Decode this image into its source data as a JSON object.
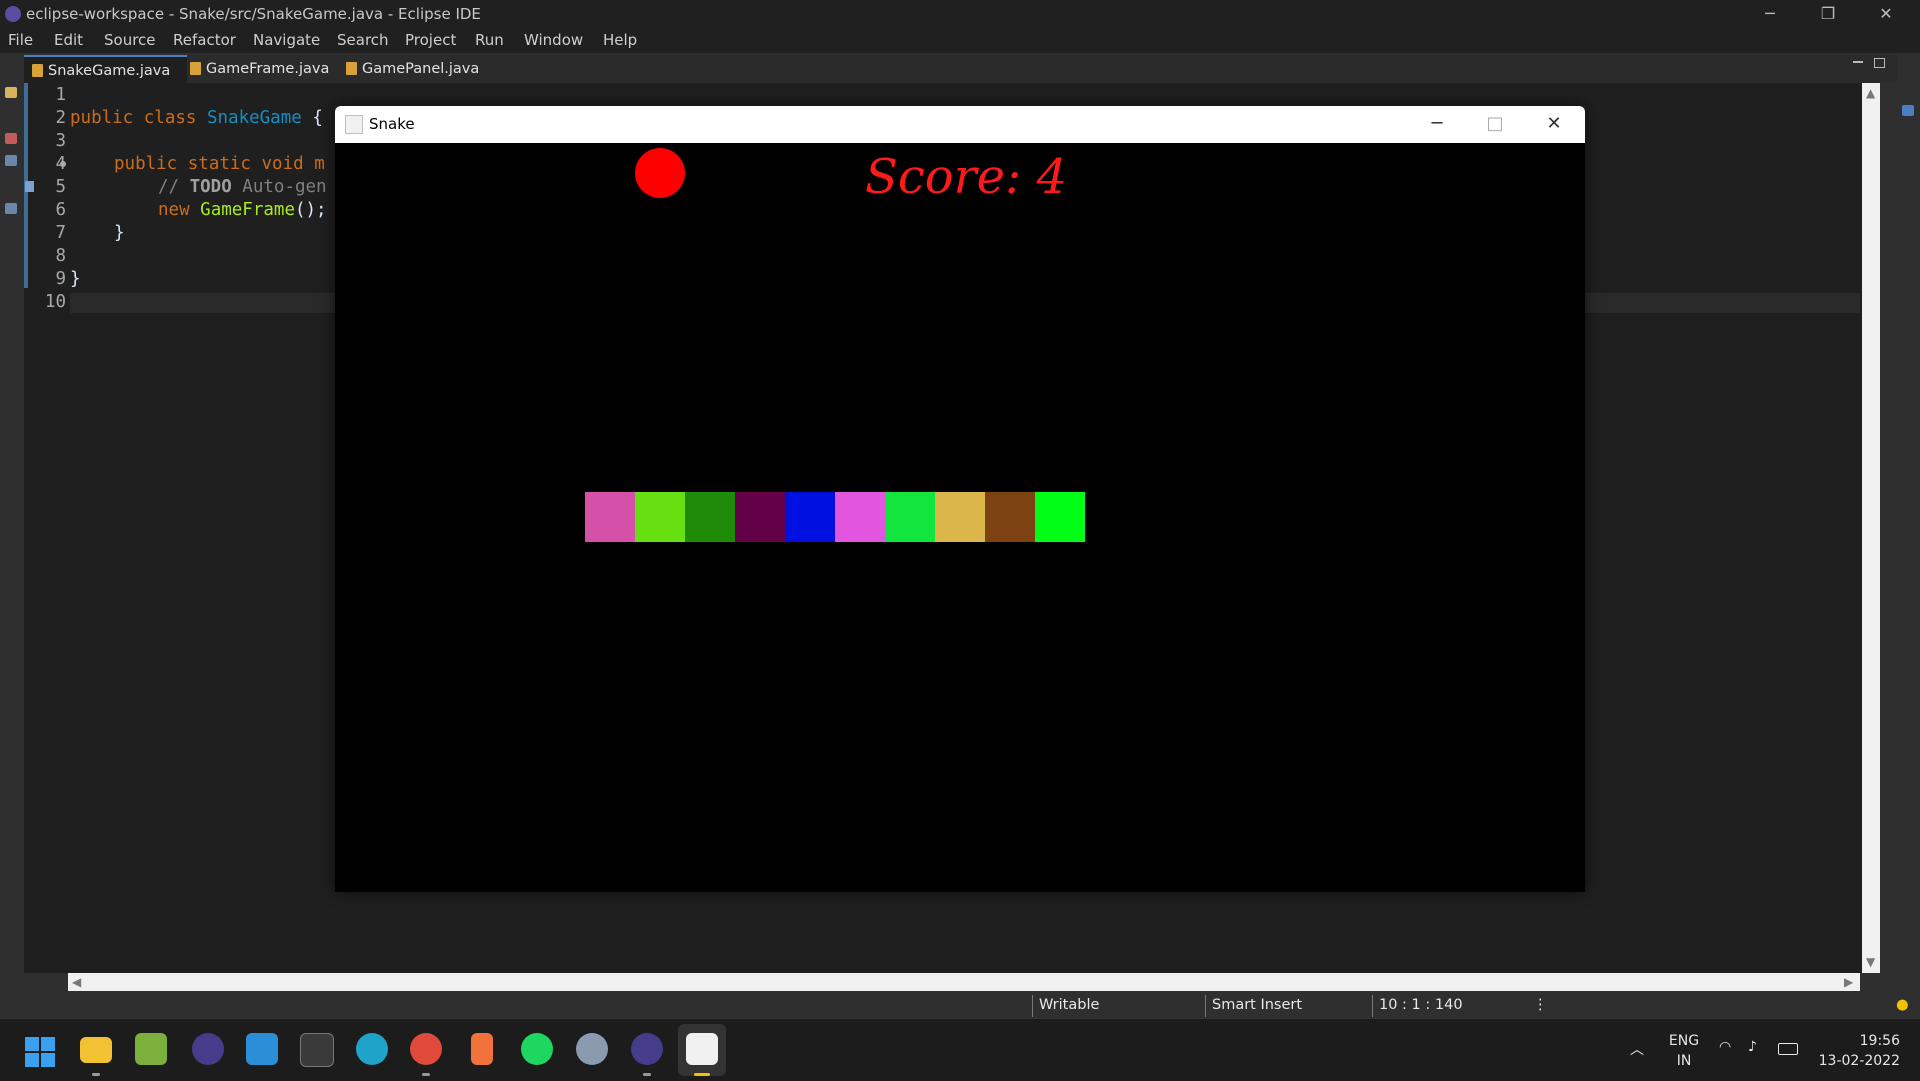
{
  "window": {
    "title": "eclipse-workspace - Snake/src/SnakeGame.java - Eclipse IDE",
    "min": "─",
    "max": "❐",
    "close": "✕"
  },
  "menu": [
    "File",
    "Edit",
    "Source",
    "Refactor",
    "Navigate",
    "Search",
    "Project",
    "Run",
    "Window",
    "Help"
  ],
  "tabs": [
    {
      "label": "SnakeGame.java",
      "close": "×"
    },
    {
      "label": "GameFrame.java"
    },
    {
      "label": "GamePanel.java"
    }
  ],
  "editor": {
    "line_numbers": [
      "1",
      "2",
      "3",
      "4",
      "5",
      "6",
      "7",
      "8",
      "9",
      "10"
    ],
    "code": {
      "l2_kw": "public class ",
      "l2_cls": "SnakeGame",
      "l2_rest": " {",
      "l4_kw": "public static void",
      "l4_rest": " m",
      "l5_cm": "// ",
      "l5_todo": "TODO",
      "l5_rest": " Auto-gen",
      "l6_kw": "new ",
      "l6_m": "GameFrame",
      "l6_rest": "();",
      "l7": "}",
      "l9": "}"
    }
  },
  "snake_window": {
    "title": "Snake",
    "min": "─",
    "max": "□",
    "close": "✕",
    "score_label": "Score: 4",
    "segments": [
      "#d550a8",
      "#66e010",
      "#1e8c08",
      "#630047",
      "#0010e0",
      "#e255de",
      "#12e53e",
      "#dbb64b",
      "#7c4212",
      "#00ff14"
    ],
    "apple_color": "#ff0000"
  },
  "status": {
    "writable": "Writable",
    "insert": "Smart Insert",
    "position": "10 : 1 : 140"
  },
  "tray": {
    "lang1": "ENG",
    "lang2": "IN",
    "time": "19:56",
    "date": "13-02-2022"
  }
}
